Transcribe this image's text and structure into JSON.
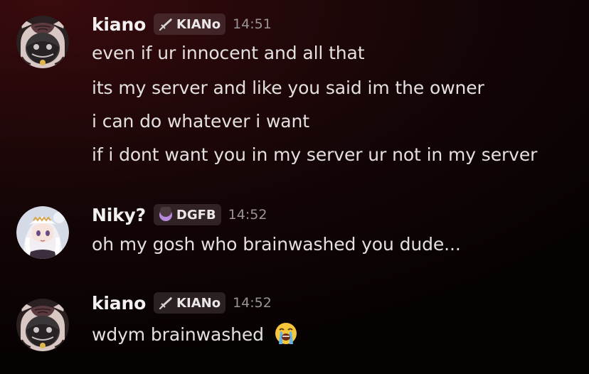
{
  "messages": [
    {
      "username": "kiano",
      "tag_label": "KIANo",
      "tag_icon": "sword-icon",
      "timestamp": "14:51",
      "lines": [
        "even if ur innocent and all that",
        "its my server and like you said im the owner",
        "i can do whatever i want",
        "if i dont want you in my server ur not in my server"
      ]
    },
    {
      "username": "Niky?",
      "tag_label": "DGFB",
      "tag_icon": "crescent-moon-icon",
      "timestamp": "14:52",
      "lines": [
        "oh my gosh who brainwashed you dude..."
      ]
    },
    {
      "username": "kiano",
      "tag_label": "KIANo",
      "tag_icon": "sword-icon",
      "timestamp": "14:52",
      "lines": [
        "wdym brainwashed"
      ],
      "emoji": "loudly-crying-face-emoji"
    }
  ],
  "colors": {
    "background": "#1a0607",
    "username": "#f2f0f0",
    "message_text": "#e4e0e0",
    "timestamp": "#9a9496",
    "tag_bg": "#4a3a3e"
  }
}
